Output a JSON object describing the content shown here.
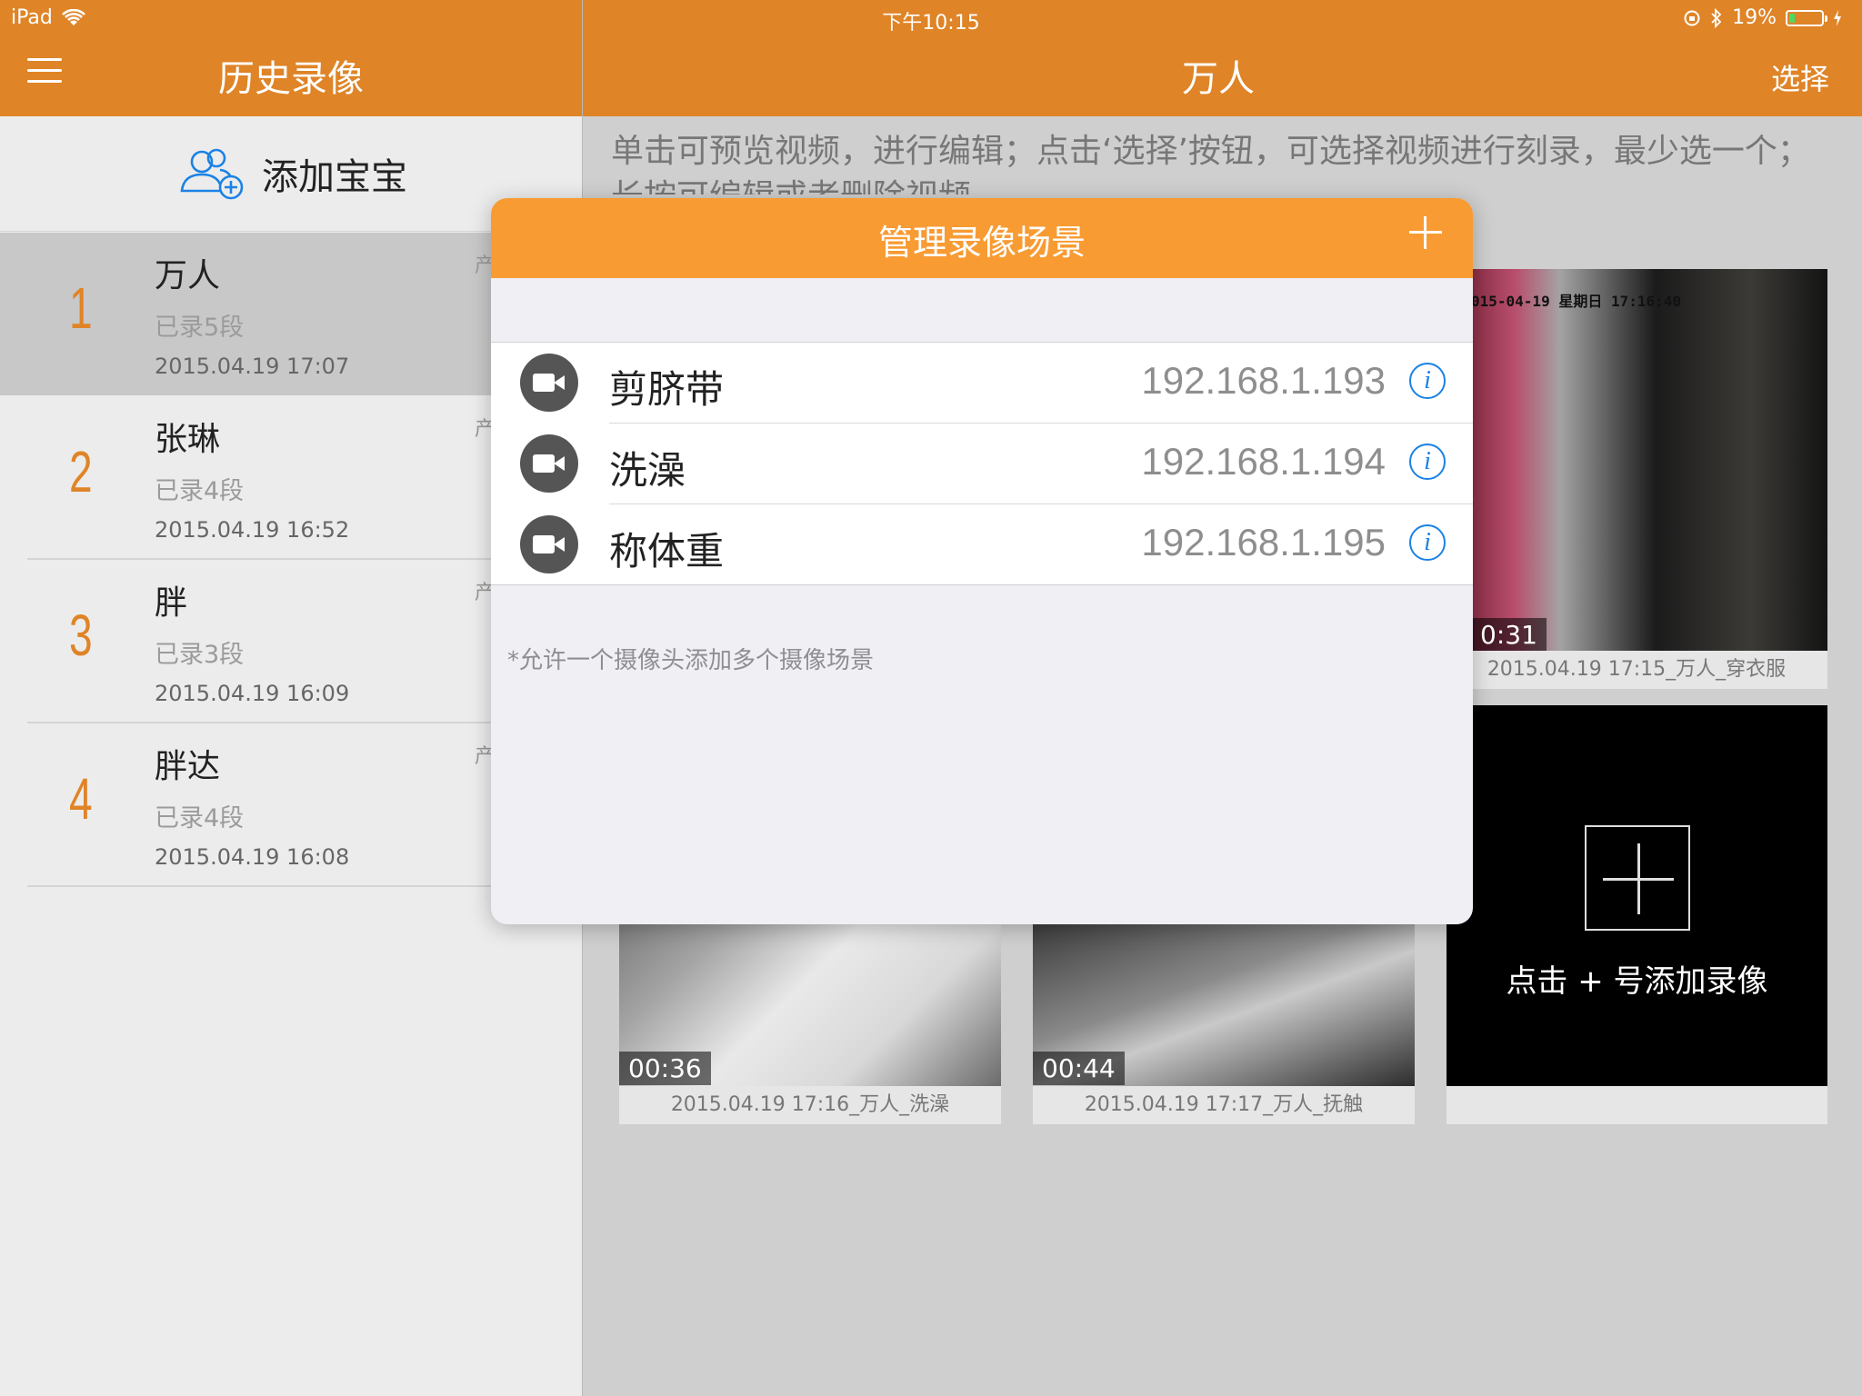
{
  "status_bar": {
    "device": "iPad",
    "time": "下午10:15",
    "battery_percent": "19%",
    "battery_level": 0.19
  },
  "left_nav": {
    "title": "历史录像"
  },
  "right_nav": {
    "title": "万人",
    "select_label": "选择"
  },
  "add_baby": {
    "label": "添加宝宝"
  },
  "babies": [
    {
      "number": "1",
      "name": "万人",
      "count": "已录5段",
      "date": "2015.04.19 17:07",
      "prod": "产",
      "selected": true
    },
    {
      "number": "2",
      "name": "张琳",
      "count": "已录4段",
      "date": "2015.04.19 16:52",
      "prod": "产"
    },
    {
      "number": "3",
      "name": "胖",
      "count": "已录3段",
      "date": "2015.04.19 16:09",
      "prod": "产-"
    },
    {
      "number": "4",
      "name": "胖达",
      "count": "已录4段",
      "date": "2015.04.19 16:08",
      "prod": "产-"
    }
  ],
  "instructions": "单击可预览视频，进行编辑；点击‘选择’按钮，可选择视频进行刻录，最少选一个；长按可编辑或者删除视频",
  "videos": [
    {
      "duration": "0:31",
      "caption": "2015.04.19 17:15_万人_穿衣服",
      "stamp": "015-04-19 星期日 17:16:40"
    },
    {
      "duration": "00:36",
      "caption": "2015.04.19 17:16_万人_洗澡"
    },
    {
      "duration": "00:44",
      "caption": "2015.04.19 17:17_万人_抚触"
    }
  ],
  "add_video": {
    "label": "点击 + 号添加录像"
  },
  "dialog": {
    "title": "管理录像场景",
    "scenes": [
      {
        "name": "剪脐带",
        "ip": "192.168.1.193"
      },
      {
        "name": "洗澡",
        "ip": "192.168.1.194"
      },
      {
        "name": "称体重",
        "ip": "192.168.1.195"
      }
    ],
    "note": "*允许一个摄像头添加多个摄像场景"
  },
  "colors": {
    "accent": "#df8427",
    "dialog_header": "#f89b33",
    "info_blue": "#1a82e6"
  }
}
